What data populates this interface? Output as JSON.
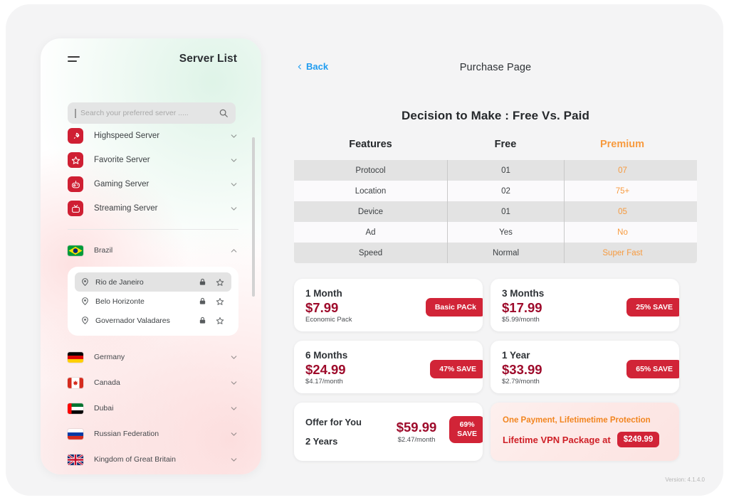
{
  "sidebar": {
    "title": "Server List",
    "menu_icon": "hamburger-icon",
    "search": {
      "placeholder": "Search your preferred server .....",
      "value": "",
      "icon": "search-icon"
    },
    "categories": [
      {
        "label": "Highspeed Server",
        "icon": "rocket-icon",
        "chevron": "chevron-down-icon"
      },
      {
        "label": "Favorite Server",
        "icon": "star-icon",
        "chevron": "chevron-down-icon"
      },
      {
        "label": "Gaming Server",
        "icon": "gaming-icon",
        "chevron": "chevron-down-icon"
      },
      {
        "label": "Streaming Server",
        "icon": "tv-icon",
        "chevron": "chevron-down-icon"
      }
    ],
    "countries": [
      {
        "label": "Brazil",
        "flag": "brazil-flag",
        "expanded": true,
        "chevron": "chevron-up-icon"
      },
      {
        "label": "Germany",
        "flag": "germany-flag",
        "expanded": false,
        "chevron": "chevron-down-icon"
      },
      {
        "label": "Canada",
        "flag": "canada-flag",
        "expanded": false,
        "chevron": "chevron-down-icon"
      },
      {
        "label": "Dubai",
        "flag": "uae-flag",
        "expanded": false,
        "chevron": "chevron-down-icon"
      },
      {
        "label": "Russian Federation",
        "flag": "russia-flag",
        "expanded": false,
        "chevron": "chevron-down-icon"
      },
      {
        "label": "Kingdom of Great Britain",
        "flag": "uk-flag",
        "expanded": false,
        "chevron": "chevron-down-icon"
      }
    ],
    "cities": [
      {
        "label": "Rio de Janeiro",
        "selected": true,
        "locked": true,
        "favorite": false
      },
      {
        "label": "Belo Horizonte",
        "selected": false,
        "locked": true,
        "favorite": false
      },
      {
        "label": "Governador Valadares",
        "selected": false,
        "locked": true,
        "favorite": false
      }
    ]
  },
  "main": {
    "back_label": "Back",
    "page_title": "Purchase Page",
    "section_title": "Decision to Make : Free Vs. Paid",
    "version": "Version: 4.1.4.0"
  },
  "comparison": {
    "headers": [
      "Features",
      "Free",
      "Premium"
    ],
    "rows": [
      {
        "feature": "Protocol",
        "free": "01",
        "premium": "07"
      },
      {
        "feature": "Location",
        "free": "02",
        "premium": "75+"
      },
      {
        "feature": "Device",
        "free": "01",
        "premium": "05"
      },
      {
        "feature": "Ad",
        "free": "Yes",
        "premium": "No"
      },
      {
        "feature": "Speed",
        "free": "Normal",
        "premium": "Super Fast"
      }
    ],
    "premium_color": "#f79a3e"
  },
  "plans": [
    {
      "term": "1 Month",
      "price": "$7.99",
      "sub": "Economic Pack",
      "badge": "Basic PACk"
    },
    {
      "term": "3 Months",
      "price": "$17.99",
      "sub": "$5.99/month",
      "badge": "25% SAVE"
    },
    {
      "term": "6 Months",
      "price": "$24.99",
      "sub": "$4.17/month",
      "badge": "47% SAVE"
    },
    {
      "term": "1 Year",
      "price": "$33.99",
      "sub": "$2.79/month",
      "badge": "65% SAVE"
    }
  ],
  "offer": {
    "line1": "Offer for You",
    "line2": "2 Years",
    "price": "$59.99",
    "sub": "$2.47/month",
    "badge_line1": "69%",
    "badge_line2": "SAVE"
  },
  "lifetime": {
    "line1": "One Payment, Lifetimetime Protection",
    "line2": "Lifetime VPN Package at",
    "price": "$249.99"
  },
  "colors": {
    "brand_red": "#d12437",
    "price_maroon": "#9e0b2b",
    "accent_orange": "#f79a3e",
    "link_blue": "#1f9cf0"
  }
}
